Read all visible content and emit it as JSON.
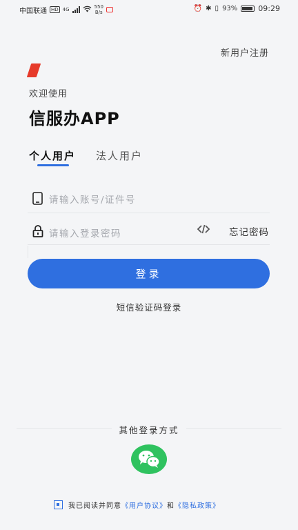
{
  "status_bar": {
    "carrier": "中国联通",
    "hd": "HD",
    "network": "4G",
    "net_speed_value": "550",
    "net_speed_unit": "B/s",
    "battery_percent": "93%",
    "time": "09:29"
  },
  "header": {
    "register_link": "新用户注册",
    "welcome": "欢迎使用",
    "app_title": "信服办APP"
  },
  "tabs": [
    {
      "label": "个人用户",
      "active": true
    },
    {
      "label": "法人用户",
      "active": false
    }
  ],
  "form": {
    "account_placeholder": "请输入账号/证件号",
    "password_placeholder": "请输入登录密码",
    "forgot_password": "忘记密码",
    "login_button": "登录",
    "sms_login": "短信验证码登录"
  },
  "other_login": {
    "label": "其他登录方式",
    "methods": [
      "wechat-icon"
    ]
  },
  "agreement": {
    "prefix": "我已阅读并同意",
    "user_agreement": "《用户协议》",
    "and": "和",
    "privacy_policy": "《隐私政策》"
  },
  "colors": {
    "accent": "#2f6fe0",
    "logo_red": "#e63a2a",
    "wechat_green": "#2fc25f",
    "background": "#f4f5f7"
  }
}
